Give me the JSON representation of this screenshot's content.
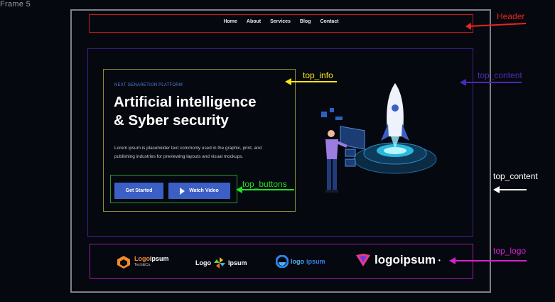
{
  "frame_tag": "Frame 5",
  "header": {
    "label": "Header",
    "nav": [
      "Home",
      "About",
      "Services",
      "Blog",
      "Contact"
    ]
  },
  "top_content": {
    "label": "top_content",
    "label_outer": "top_content"
  },
  "top_info": {
    "label": "top_info",
    "eyebrow": "NEXT GENARETION PLATFORM",
    "title_line1": "Artificial intelligence",
    "title_line2": "& Syber security",
    "description": "Lorem ipsum is placeholder text commonly used in the graphic, print, and publishing industries for previewing layouts and visual mockups."
  },
  "top_buttons": {
    "label": "top_buttons",
    "get_started": "Get Started",
    "watch_video": "Watch Video"
  },
  "top_logo": {
    "label": "top_logo",
    "logos": [
      {
        "name": "Logoipsum",
        "accent": "Logo",
        "rest": "ipsum",
        "sub": "Tech&Co."
      },
      {
        "left": "Logo",
        "right": "Ipsum"
      },
      {
        "a": "logo",
        "b": "ipsum"
      },
      {
        "text": "logoipsum"
      }
    ]
  },
  "colors": {
    "background": "#06080f",
    "header_box": "#c21b1b",
    "content_box": "#3d1e8c",
    "info_box": "#8b8f2e",
    "buttons_box": "#2a9a2a",
    "logo_box": "#a01aa8",
    "button": "#3b5fc4",
    "label_header": "#e8251f",
    "label_info": "#f5e51a",
    "label_content": "#4b2bb5",
    "label_buttons": "#22e022",
    "label_logo": "#d91fd3"
  }
}
